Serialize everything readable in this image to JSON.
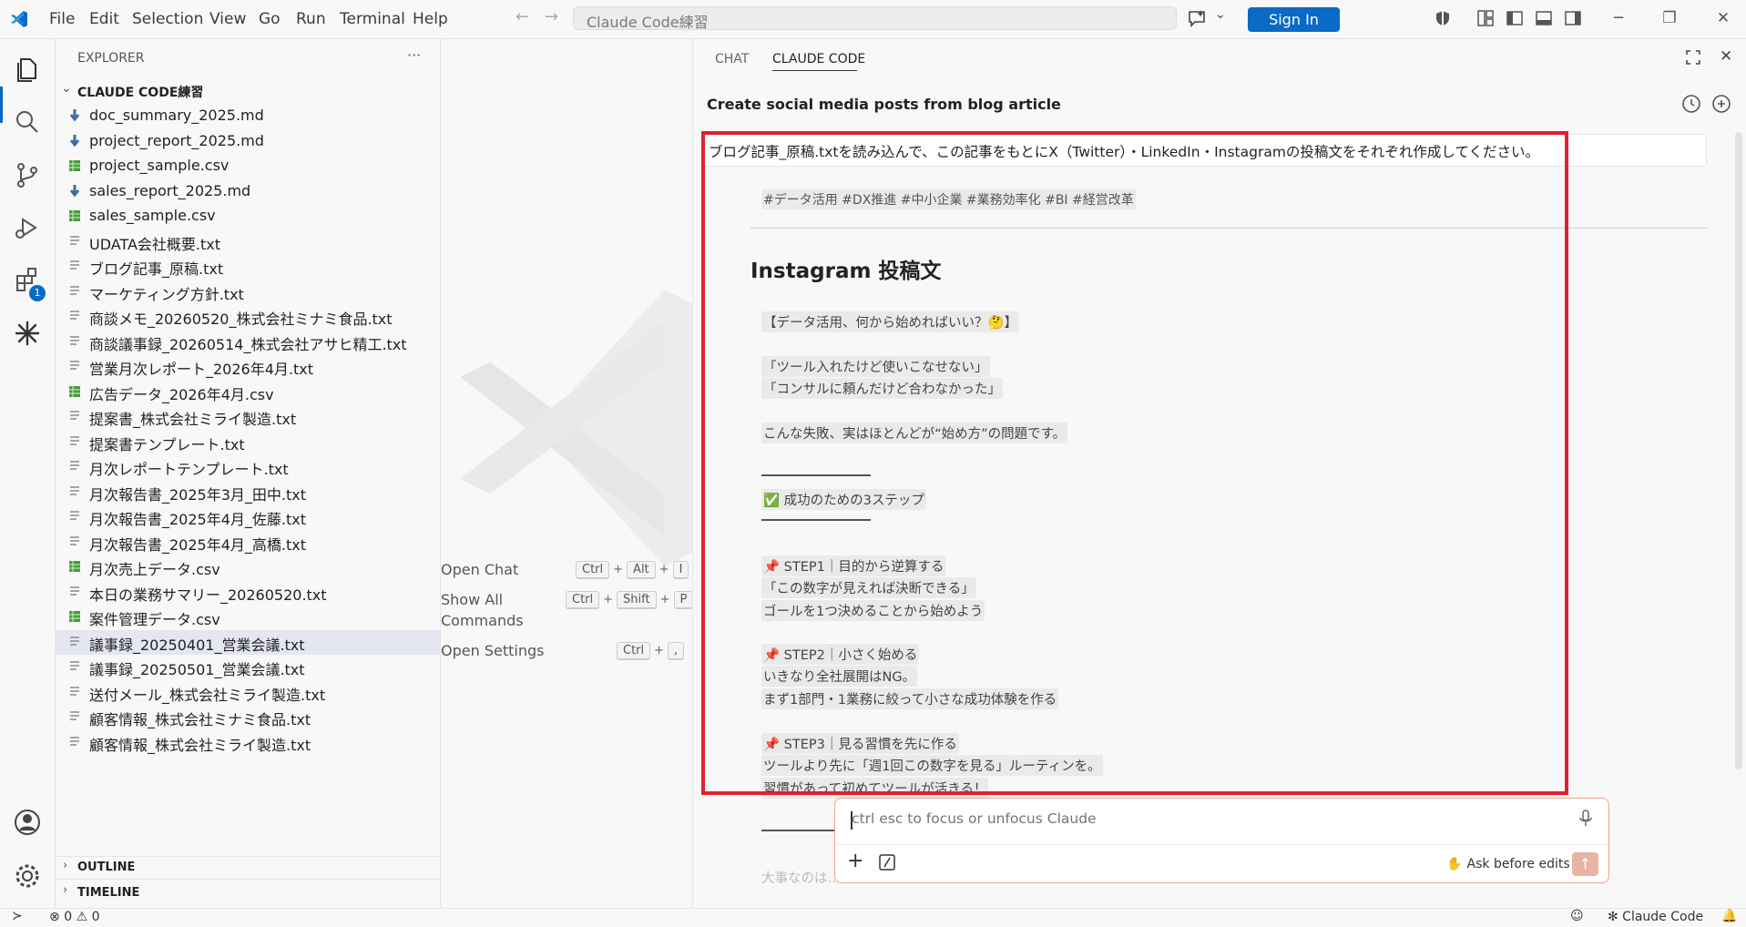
{
  "menu": [
    "File",
    "Edit",
    "Selection",
    "View",
    "Go",
    "Run",
    "Terminal",
    "Help"
  ],
  "command_center": {
    "text": "Claude Code練習"
  },
  "sign_in": "Sign In",
  "explorer": {
    "title": "EXPLORER",
    "more": "···",
    "folder": "CLAUDE CODE練習",
    "files": [
      {
        "name": "doc_summary_2025.md",
        "type": "md"
      },
      {
        "name": "project_report_2025.md",
        "type": "md"
      },
      {
        "name": "project_sample.csv",
        "type": "csv"
      },
      {
        "name": "sales_report_2025.md",
        "type": "md"
      },
      {
        "name": "sales_sample.csv",
        "type": "csv"
      },
      {
        "name": "UDATA会社概要.txt",
        "type": "txt"
      },
      {
        "name": "ブログ記事_原稿.txt",
        "type": "txt"
      },
      {
        "name": "マーケティング方針.txt",
        "type": "txt"
      },
      {
        "name": "商談メモ_20260520_株式会社ミナミ食品.txt",
        "type": "txt"
      },
      {
        "name": "商談議事録_20260514_株式会社アサヒ精工.txt",
        "type": "txt"
      },
      {
        "name": "営業月次レポート_2026年4月.txt",
        "type": "txt"
      },
      {
        "name": "広告データ_2026年4月.csv",
        "type": "csv"
      },
      {
        "name": "提案書_株式会社ミライ製造.txt",
        "type": "txt"
      },
      {
        "name": "提案書テンプレート.txt",
        "type": "txt"
      },
      {
        "name": "月次レポートテンプレート.txt",
        "type": "txt"
      },
      {
        "name": "月次報告書_2025年3月_田中.txt",
        "type": "txt"
      },
      {
        "name": "月次報告書_2025年4月_佐藤.txt",
        "type": "txt"
      },
      {
        "name": "月次報告書_2025年4月_高橋.txt",
        "type": "txt"
      },
      {
        "name": "月次売上データ.csv",
        "type": "csv"
      },
      {
        "name": "本日の業務サマリー_20260520.txt",
        "type": "txt"
      },
      {
        "name": "案件管理データ.csv",
        "type": "csv"
      },
      {
        "name": "議事録_20250401_営業会議.txt",
        "type": "txt",
        "selected": true
      },
      {
        "name": "議事録_20250501_営業会議.txt",
        "type": "txt"
      },
      {
        "name": "送付メール_株式会社ミライ製造.txt",
        "type": "txt"
      },
      {
        "name": "顧客情報_株式会社ミナミ食品.txt",
        "type": "txt"
      },
      {
        "name": "顧客情報_株式会社ミライ製造.txt",
        "type": "txt"
      }
    ],
    "outline": "OUTLINE",
    "timeline": "TIMELINE",
    "extensions_badge": "1"
  },
  "welcome": {
    "open_chat": "Open Chat",
    "open_chat_keys": [
      "Ctrl",
      "Alt",
      "I"
    ],
    "show_all": "Show All",
    "commands": "Commands",
    "show_all_keys": [
      "Ctrl",
      "Shift",
      "P"
    ],
    "open_settings": "Open Settings",
    "open_settings_keys": [
      "Ctrl",
      ","
    ],
    "plus": "+"
  },
  "panel": {
    "tabs": [
      "CHAT",
      "CLAUDE CODE"
    ],
    "title": "Create social media posts from blog article",
    "user_message": "ブログ記事_原稿.txtを読み込んで、この記事をもとにX（Twitter）・LinkedIn・Instagramの投稿文をそれぞれ作成してください。",
    "hashtags": "#データ活用 #DX推進 #中小企業 #業務効率化 #BI #経営改革",
    "instagram_heading": "Instagram 投稿文",
    "lines": {
      "l1": "【データ活用、何から始めればいい？🤔】",
      "l2": "「ツール入れたけど使いこなせない」",
      "l3": "「コンサルに頼んだけど合わなかった」",
      "l4": "こんな失敗、実はほとんどが“始め方”の問題です。",
      "l5": "✅ 成功のための3ステップ",
      "s1a": "📌 STEP1｜目的から逆算する",
      "s1b": "「この数字が見えれば決断できる」",
      "s1c": "ゴールを1つ決めることから始めよう",
      "s2a": "📌 STEP2｜小さく始める",
      "s2b": "いきなり全社展開はNG。",
      "s2c": "まず1部門・1業務に絞って小さな成功体験を作る",
      "s3a": "📌 STEP3｜見る習慣を先に作る",
      "s3b": "ツールより先に「週1回この数字を見る」ルーティンを。",
      "s3c": "習慣があって初めてツールが活きる！",
      "tail": "大事なのは…"
    },
    "input_placeholder": "ctrl esc to focus or unfocus Claude",
    "ask_before_edits": "Ask before edits"
  },
  "status": {
    "errors": "0",
    "warnings": "0",
    "claude_code": "✻ Claude Code"
  },
  "colors": {
    "accent": "#0a6ac5",
    "highlight_box": "#e0212f",
    "input_border": "#f0a48b",
    "send_button": "#e8b4a4"
  }
}
